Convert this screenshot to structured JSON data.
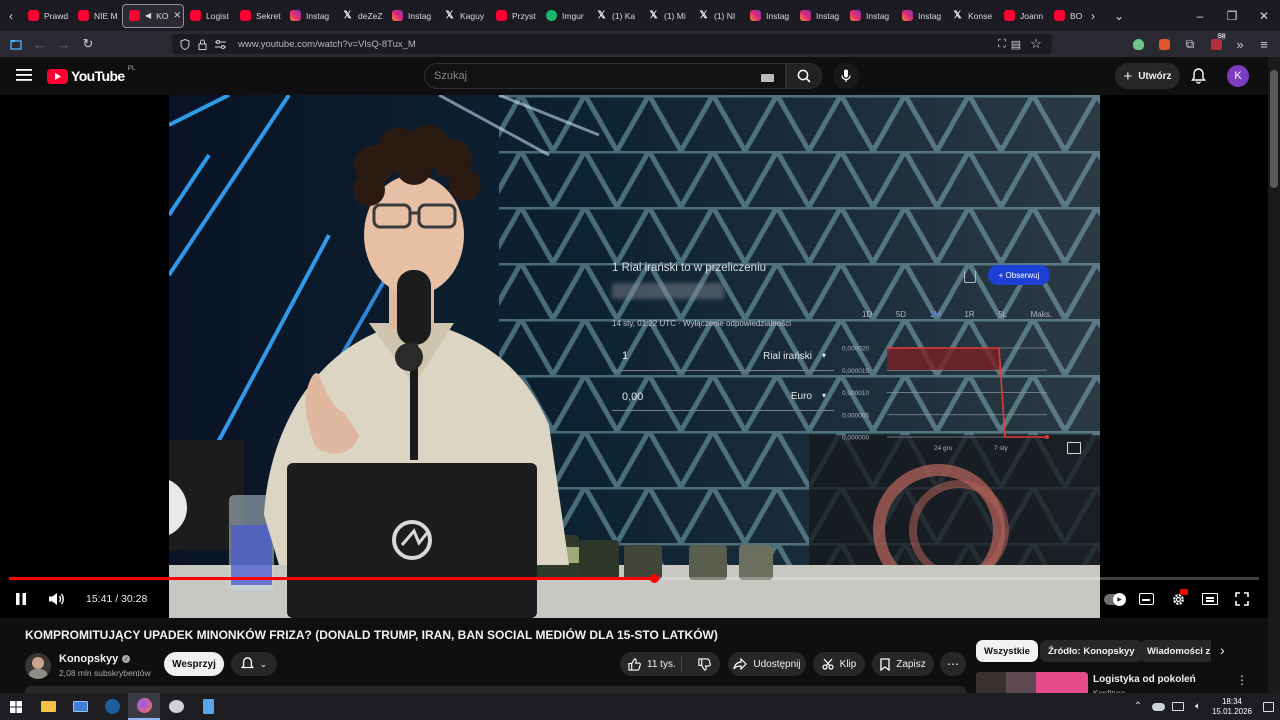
{
  "browser": {
    "tabs": [
      {
        "label": "Prawd",
        "icon": "youtube"
      },
      {
        "label": "NIE M",
        "icon": "youtube"
      },
      {
        "label": "KO",
        "icon": "youtube",
        "active": true
      },
      {
        "label": "Logist",
        "icon": "youtube"
      },
      {
        "label": "Sekret",
        "icon": "youtube"
      },
      {
        "label": "Instag",
        "icon": "instagram"
      },
      {
        "label": "deZeZ",
        "icon": "x"
      },
      {
        "label": "Instag",
        "icon": "instagram"
      },
      {
        "label": "Kaguy",
        "icon": "x"
      },
      {
        "label": "Przyst",
        "icon": "youtube"
      },
      {
        "label": "Imgur",
        "icon": "imgur"
      },
      {
        "label": "(1) Ka",
        "icon": "x"
      },
      {
        "label": "(1) Mi",
        "icon": "x"
      },
      {
        "label": "(1) NI",
        "icon": "x"
      },
      {
        "label": "Instag",
        "icon": "instagram"
      },
      {
        "label": "Instag",
        "icon": "instagram"
      },
      {
        "label": "Instag",
        "icon": "instagram"
      },
      {
        "label": "Instag",
        "icon": "instagram"
      },
      {
        "label": "Konse",
        "icon": "x"
      },
      {
        "label": "Joann",
        "icon": "youtube"
      },
      {
        "label": "BO",
        "icon": "youtube"
      }
    ],
    "url": "www.youtube.com/watch?v=VlsQ-8Tux_M",
    "extension_badge": "58"
  },
  "youtube": {
    "logo_text": "YouTube",
    "region": "PL",
    "search_placeholder": "Szukaj",
    "create_label": "Utwórz",
    "avatar_letter": "K"
  },
  "video_overlay": {
    "heading": "1 Rial irański to w przeliczeniu",
    "timestamp": "14 sty, 01:22 UTC · Wyłączenie odpowiedzialności",
    "follow_label": "+ Obserwuj",
    "ranges": [
      "1D",
      "5D",
      "1M",
      "1R",
      "5L",
      "Maks."
    ],
    "from_amount": "1",
    "from_currency": "Rial irański",
    "to_amount": "0,00",
    "to_currency": "Euro",
    "y_ticks": [
      "0,000020",
      "0,000015",
      "0,000010",
      "0,000005",
      "0,000000"
    ],
    "x_ticks": [
      "24 gru",
      "7 sty"
    ]
  },
  "player": {
    "current_time": "15:41",
    "duration": "30:28",
    "progress": 0.516
  },
  "video_info": {
    "title": "KOMPROMITUJĄCY UPADEK MINONKÓW FRIZA? (DONALD TRUMP, IRAN, BAN SOCIAL MEDIÓW DLA 15-STO LATKÓW)",
    "channel": "Konopskyy",
    "subscribers": "2,08 mln subskrybentów",
    "support_label": "Wesprzyj",
    "likes": "11 tys.",
    "share_label": "Udostępnij",
    "clip_label": "Klip",
    "save_label": "Zapisz"
  },
  "sidebar": {
    "chips": [
      "Wszystkie",
      "Źródło: Konopskyy",
      "Wiadomości z"
    ],
    "next_video_title": "Logistyka od pokoleń",
    "next_video_channel": "Konfitura"
  },
  "taskbar": {
    "time": "18:34",
    "date": "15.01.2026"
  }
}
